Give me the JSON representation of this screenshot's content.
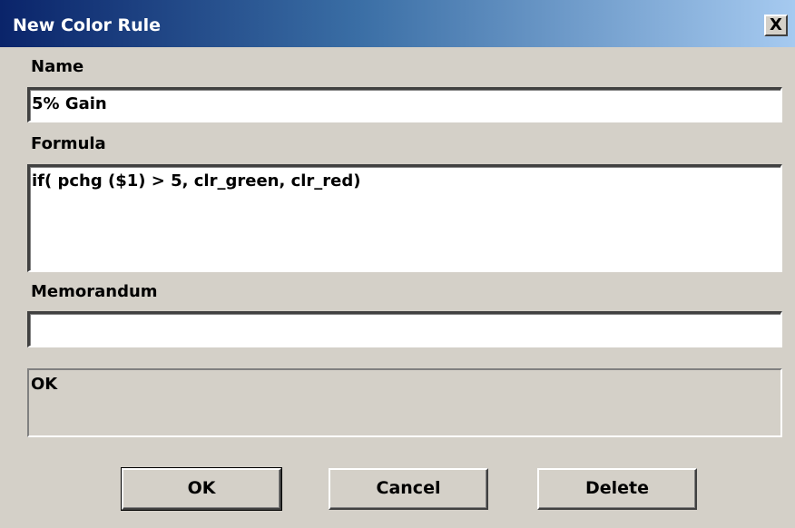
{
  "window": {
    "title": "New Color Rule",
    "close_glyph": "X"
  },
  "form": {
    "name_label": "Name",
    "name_value": "5% Gain",
    "formula_label": "Formula",
    "formula_value": "if( pchg ($1) > 5, clr_green, clr_red)",
    "memorandum_label": "Memorandum",
    "memorandum_value": "",
    "status_text": "OK"
  },
  "buttons": {
    "ok_label": "OK",
    "cancel_label": "Cancel",
    "delete_label": "Delete"
  },
  "colors": {
    "title_bar_start": "#0a246a",
    "title_bar_end": "#a6caf0",
    "dialog_background": "#d4d0c8",
    "field_background": "#ffffff"
  }
}
